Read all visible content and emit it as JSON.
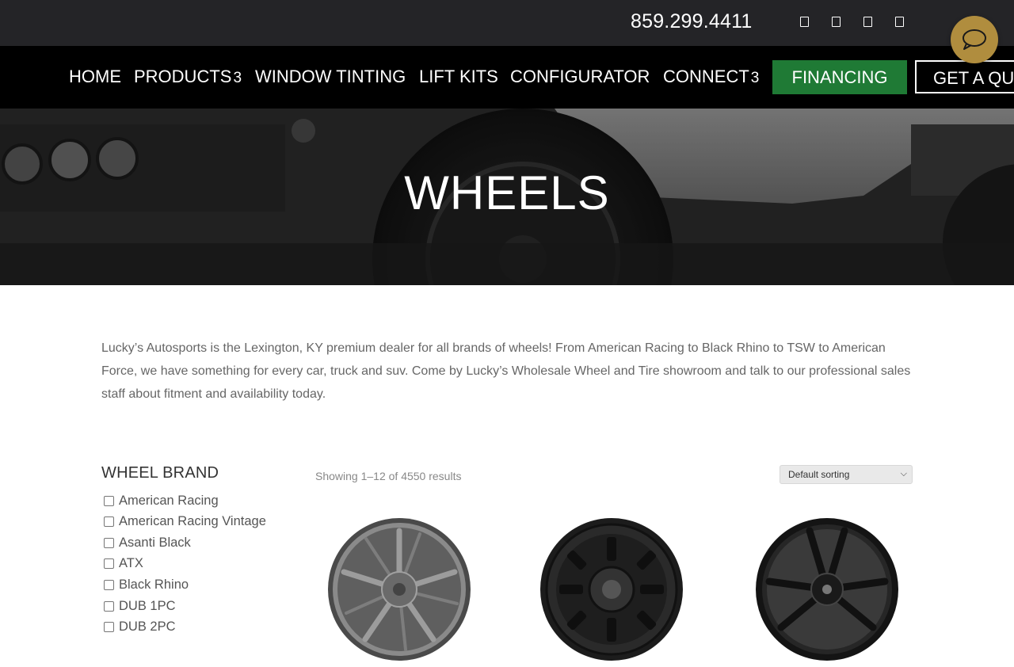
{
  "topbar": {
    "phone": "859.299.4411",
    "social_icons": [
      "social-icon-1",
      "social-icon-2",
      "social-icon-3",
      "social-icon-4"
    ],
    "chat_icon": "chat-bubble-icon",
    "colors": {
      "background": "#242427",
      "chat": "#b08d3e"
    }
  },
  "nav": {
    "items": [
      {
        "label": "HOME"
      },
      {
        "label": "PRODUCTS",
        "suffix": "3"
      },
      {
        "label": "WINDOW TINTING"
      },
      {
        "label": "LIFT KITS"
      },
      {
        "label": "CONFIGURATOR"
      },
      {
        "label": "CONNECT",
        "suffix": "3"
      }
    ],
    "financing": "FINANCING",
    "quote": "GET A QUOTE",
    "colors": {
      "financing": "#1f7a35"
    }
  },
  "hero": {
    "title": "WHEELS"
  },
  "intro": {
    "text": "Lucky’s Autosports is the Lexington, KY premium dealer for all brands of wheels! From American Racing to Black Rhino to TSW to American Force, we have something for every car, truck and suv. Come by Lucky’s Wholesale Wheel and Tire showroom and talk to our professional sales staff about fitment and availability today."
  },
  "sidebar": {
    "title": "WHEEL BRAND",
    "brands": [
      "American Racing",
      "American Racing Vintage",
      "Asanti Black",
      "ATX",
      "Black Rhino",
      "DUB 1PC",
      "DUB 2PC"
    ]
  },
  "products": {
    "result_count": "Showing 1–12 of 4550 results",
    "sort_selected": "Default sorting",
    "items": [
      "wheel-gunmetal-split-spoke",
      "wheel-black-offroad",
      "wheel-black-mesh-spoke"
    ]
  }
}
